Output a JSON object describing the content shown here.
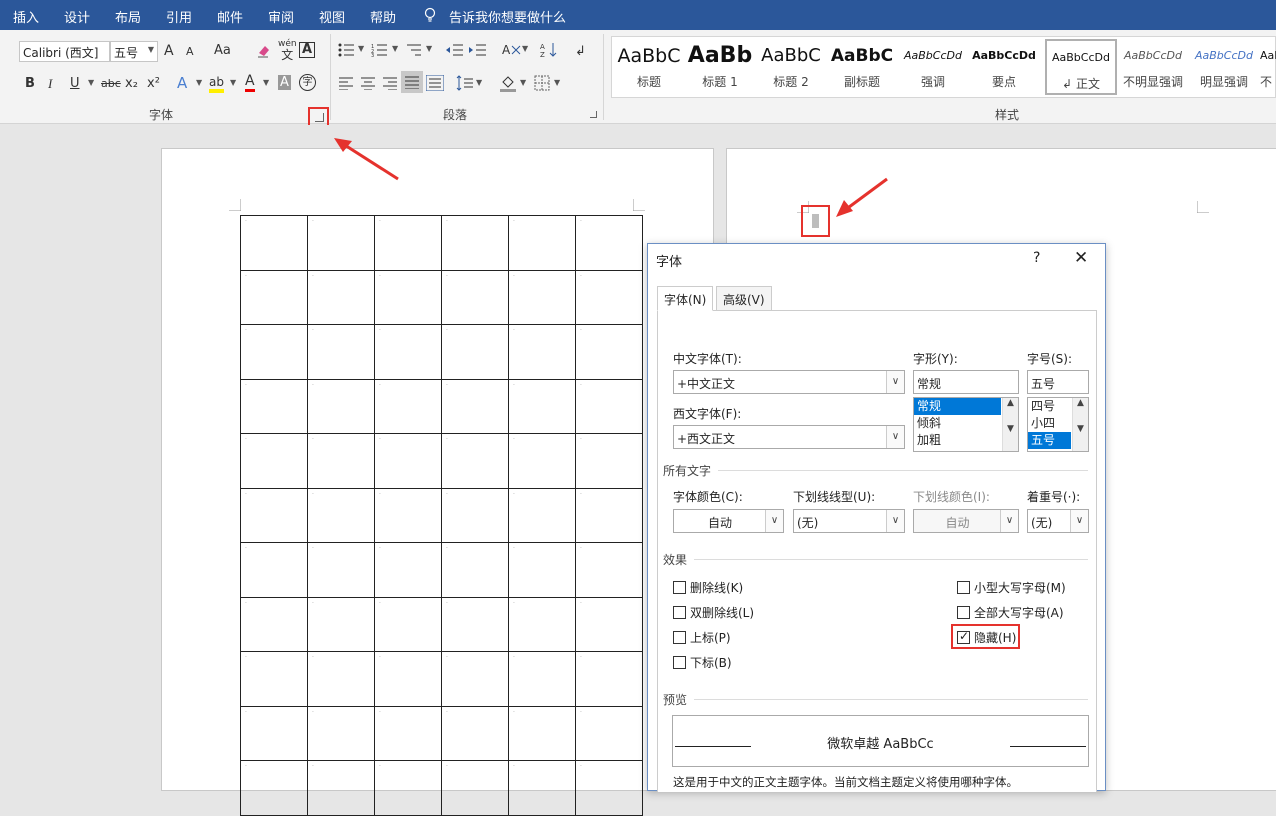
{
  "menu": {
    "items": [
      "插入",
      "设计",
      "布局",
      "引用",
      "邮件",
      "审阅",
      "视图",
      "帮助"
    ],
    "tell_me": "告诉我你想要做什么"
  },
  "ribbon": {
    "font_group": {
      "label": "字体",
      "font_name": "Calibri (西文]",
      "font_size": "五号",
      "grow_font": "A",
      "shrink_font": "A",
      "change_case": "Aa",
      "phonetic_top": "wén",
      "phonetic_bottom": "文",
      "char_border": "A",
      "bold": "B",
      "italic": "I",
      "underline": "U",
      "strikethrough": "abc",
      "subscript": "x₂",
      "superscript": "x²",
      "text_effects": "A",
      "highlight": "ab",
      "font_color": "A",
      "char_shading": "A",
      "enclose_char": "字"
    },
    "paragraph_group": {
      "label": "段落"
    },
    "styles_group": {
      "label": "样式",
      "items": [
        {
          "preview": "AaBbC",
          "name": "标题"
        },
        {
          "preview": "AaBb",
          "name": "标题 1"
        },
        {
          "preview": "AaBbC",
          "name": "标题 2"
        },
        {
          "preview": "AaBbC",
          "name": "副标题"
        },
        {
          "preview": "AaBbCcDd",
          "name": "强调"
        },
        {
          "preview": "AaBbCcDd",
          "name": "要点"
        },
        {
          "preview": "AaBbCcDd",
          "name": "正文"
        },
        {
          "preview": "AaBbCcDd",
          "name": "不明显强调"
        },
        {
          "preview": "AaBbCcDd",
          "name": "明显强调"
        },
        {
          "preview": "AaBbCcDd",
          "name": "不"
        }
      ],
      "selected_marker": "↲"
    }
  },
  "dialog": {
    "title": "字体",
    "help": "?",
    "close": "✕",
    "tabs": [
      "字体(N)",
      "高级(V)"
    ],
    "chinese_font": {
      "label": "中文字体(T):",
      "value": "+中文正文"
    },
    "western_font": {
      "label": "西文字体(F):",
      "value": "+西文正文"
    },
    "font_style": {
      "label": "字形(Y):",
      "value": "常规",
      "options": [
        "常规",
        "倾斜",
        "加粗"
      ],
      "selected": "常规"
    },
    "font_size": {
      "label": "字号(S):",
      "value": "五号",
      "options": [
        "四号",
        "小四",
        "五号"
      ],
      "selected": "五号"
    },
    "all_text_section": "所有文字",
    "font_color": {
      "label": "字体颜色(C):",
      "value": "自动"
    },
    "underline_style": {
      "label": "下划线线型(U):",
      "value": "(无)"
    },
    "underline_color": {
      "label": "下划线颜色(I):",
      "value": "自动"
    },
    "emphasis_mark": {
      "label": "着重号(·):",
      "value": "(无)"
    },
    "effects_section": "效果",
    "effects": {
      "strikethrough": {
        "label": "删除线(K)",
        "checked": false
      },
      "double_strikethrough": {
        "label": "双删除线(L)",
        "checked": false
      },
      "superscript": {
        "label": "上标(P)",
        "checked": false
      },
      "subscript": {
        "label": "下标(B)",
        "checked": false
      },
      "small_caps": {
        "label": "小型大写字母(M)",
        "checked": false
      },
      "all_caps": {
        "label": "全部大写字母(A)",
        "checked": false
      },
      "hidden": {
        "label": "隐藏(H)",
        "checked": true
      }
    },
    "preview_section": "预览",
    "preview_text": "微软卓越  AaBbCc",
    "description": "这是用于中文的正文主题字体。当前文档主题定义将使用哪种字体。"
  },
  "document": {
    "table_rows": 11,
    "table_cols": 6,
    "cell_mark": "·"
  },
  "colors": {
    "menubar": "#2b579a",
    "highlight_box": "#e5322d",
    "selection": "#0078d7"
  }
}
